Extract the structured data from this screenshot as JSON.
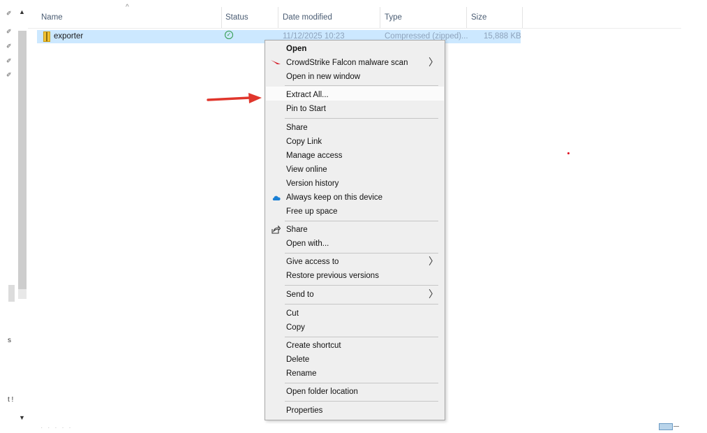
{
  "columns": {
    "name": "Name",
    "status": "Status",
    "date_modified": "Date modified",
    "type": "Type",
    "size": "Size"
  },
  "file": {
    "name": "exporter",
    "date_modified": "11/12/2025 10:23",
    "type": "Compressed (zipped)...",
    "size": "15,888 KB"
  },
  "nav_fragments": [
    "s",
    "t !"
  ],
  "context_menu": {
    "open": "Open",
    "crowdstrike": "CrowdStrike Falcon malware scan",
    "open_new_window": "Open in new window",
    "extract_all": "Extract All...",
    "pin_to_start": "Pin to Start",
    "share_onedrive": "Share",
    "copy_link": "Copy Link",
    "manage_access": "Manage access",
    "view_online": "View online",
    "version_history": "Version history",
    "always_keep": "Always keep on this device",
    "free_up_space": "Free up space",
    "share": "Share",
    "open_with": "Open with...",
    "give_access": "Give access to",
    "restore_versions": "Restore previous versions",
    "send_to": "Send to",
    "cut": "Cut",
    "copy": "Copy",
    "create_shortcut": "Create shortcut",
    "delete": "Delete",
    "rename": "Rename",
    "open_folder_location": "Open folder location",
    "properties": "Properties"
  },
  "icons": {
    "submenu": "chevron-right-icon",
    "crowdstrike": "falcon-icon",
    "onedrive": "cloud-icon",
    "share": "share-icon",
    "annotation": "red-arrow-icon"
  },
  "colors": {
    "selection": "#cce8ff",
    "menu_bg": "#efefef",
    "arrow": "#e0362c",
    "status_ok": "#2e9a49"
  }
}
